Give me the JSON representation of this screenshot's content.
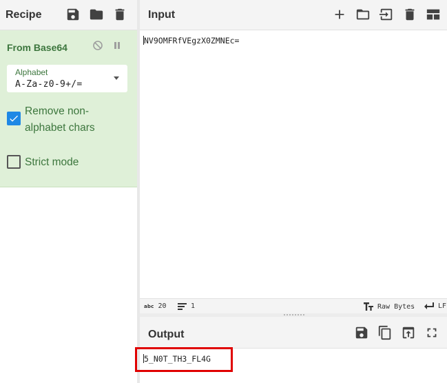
{
  "recipe": {
    "title": "Recipe",
    "icons": [
      "save-icon",
      "folder-icon",
      "trash-icon"
    ],
    "operation": {
      "name": "From Base64",
      "controls": [
        "disable-icon",
        "pause-icon"
      ],
      "alphabet": {
        "label": "Alphabet",
        "value": "A-Za-z0-9+/="
      },
      "remove_non_alphabet": {
        "label_line1": "Remove non-",
        "label_line2": "alphabet chars",
        "checked": true
      },
      "strict_mode": {
        "label": "Strict mode",
        "checked": false
      }
    }
  },
  "input": {
    "title": "Input",
    "icons": [
      "plus-icon",
      "folder-icon",
      "import-icon",
      "trash-icon",
      "layout-icon"
    ],
    "text": "NV9OMFRfVEgzX0ZMNEc=",
    "status": {
      "length": "20",
      "lines": "1",
      "encoding": "Raw Bytes",
      "eol": "LF"
    }
  },
  "output": {
    "title": "Output",
    "icons": [
      "save-icon",
      "copy-icon",
      "replace-input-icon",
      "fullscreen-icon"
    ],
    "text": "5_N0T_TH3_FL4G"
  },
  "colors": {
    "operation_bg": "#dff0d8",
    "operation_text": "#3c763d",
    "checkbox_checked": "#1e88e5",
    "highlight": "#e00000"
  }
}
